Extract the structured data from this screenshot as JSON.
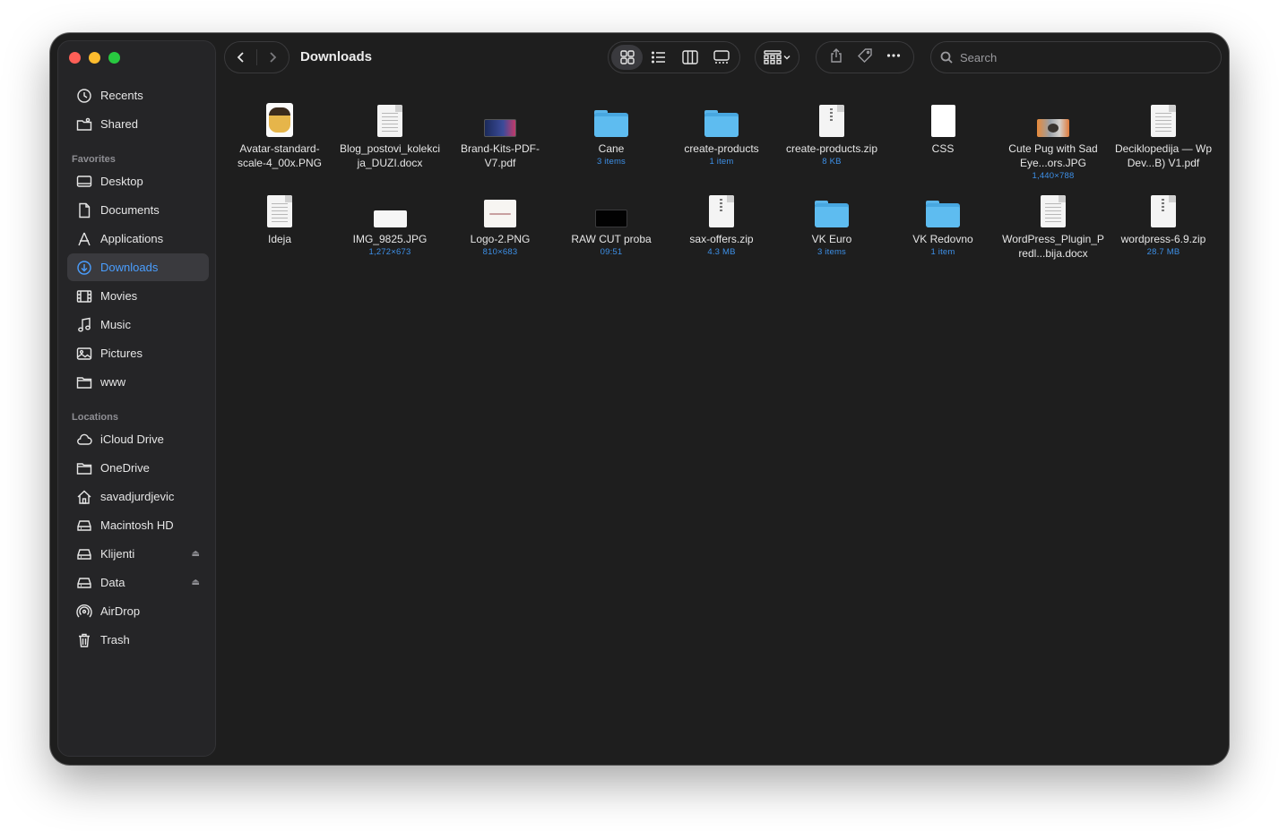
{
  "window": {
    "title": "Downloads"
  },
  "sidebar": {
    "top": [
      {
        "label": "Recents",
        "icon": "clock-icon"
      },
      {
        "label": "Shared",
        "icon": "shared-folder-icon"
      }
    ],
    "favorites_header": "Favorites",
    "favorites": [
      {
        "label": "Desktop",
        "icon": "desktop-icon"
      },
      {
        "label": "Documents",
        "icon": "document-icon"
      },
      {
        "label": "Applications",
        "icon": "applications-icon"
      },
      {
        "label": "Downloads",
        "icon": "download-icon",
        "active": true
      },
      {
        "label": "Movies",
        "icon": "film-icon"
      },
      {
        "label": "Music",
        "icon": "music-note-icon"
      },
      {
        "label": "Pictures",
        "icon": "photo-icon"
      },
      {
        "label": "www",
        "icon": "folder-icon"
      }
    ],
    "locations_header": "Locations",
    "locations": [
      {
        "label": "iCloud Drive",
        "icon": "cloud-icon"
      },
      {
        "label": "OneDrive",
        "icon": "folder-icon"
      },
      {
        "label": "savadjurdjevic",
        "icon": "home-icon"
      },
      {
        "label": "Macintosh HD",
        "icon": "disk-icon"
      },
      {
        "label": "Klijenti",
        "icon": "disk-icon",
        "eject": true
      },
      {
        "label": "Data",
        "icon": "disk-icon",
        "eject": true
      },
      {
        "label": "AirDrop",
        "icon": "airdrop-icon"
      },
      {
        "label": "Trash",
        "icon": "trash-icon"
      }
    ]
  },
  "toolbar": {
    "search_placeholder": "Search",
    "view_active": "icons"
  },
  "colors": {
    "accent": "#4a9eff",
    "folder": "#5ebcf0",
    "window_bg": "#1e1e1e",
    "sidebar_bg": "#252527"
  },
  "files": [
    {
      "name": "Avatar-standard-scale-4_00x.PNG",
      "meta": "",
      "kind": "avatar"
    },
    {
      "name": "Blog_postovi_kolekcija_DUZI.docx",
      "meta": "",
      "kind": "doc"
    },
    {
      "name": "Brand-Kits-PDF-V7.pdf",
      "meta": "",
      "kind": "pdf-brand"
    },
    {
      "name": "Cane",
      "meta": "3 items",
      "kind": "folder"
    },
    {
      "name": "create-products",
      "meta": "1 item",
      "kind": "folder"
    },
    {
      "name": "create-products.zip",
      "meta": "8 KB",
      "kind": "zip"
    },
    {
      "name": "CSS",
      "meta": "",
      "kind": "blank"
    },
    {
      "name": "Cute Pug with Sad Eye...ors.JPG",
      "meta": "1,440×788",
      "kind": "pug"
    },
    {
      "name": "Deciklopedija — Wp Dev...B) V1.pdf",
      "meta": "",
      "kind": "doc"
    },
    {
      "name": "Ideja",
      "meta": "",
      "kind": "doc"
    },
    {
      "name": "IMG_9825.JPG",
      "meta": "1,272×673",
      "kind": "white-img"
    },
    {
      "name": "Logo-2.PNG",
      "meta": "810×683",
      "kind": "logo"
    },
    {
      "name": "RAW CUT proba",
      "meta": "09:51",
      "kind": "video"
    },
    {
      "name": "sax-offers.zip",
      "meta": "4.3 MB",
      "kind": "zip"
    },
    {
      "name": "VK Euro",
      "meta": "3 items",
      "kind": "folder"
    },
    {
      "name": "VK Redovno",
      "meta": "1 item",
      "kind": "folder"
    },
    {
      "name": "WordPress_Plugin_Predl...bija.docx",
      "meta": "",
      "kind": "doc"
    },
    {
      "name": "wordpress-6.9.zip",
      "meta": "28.7 MB",
      "kind": "zip"
    }
  ]
}
